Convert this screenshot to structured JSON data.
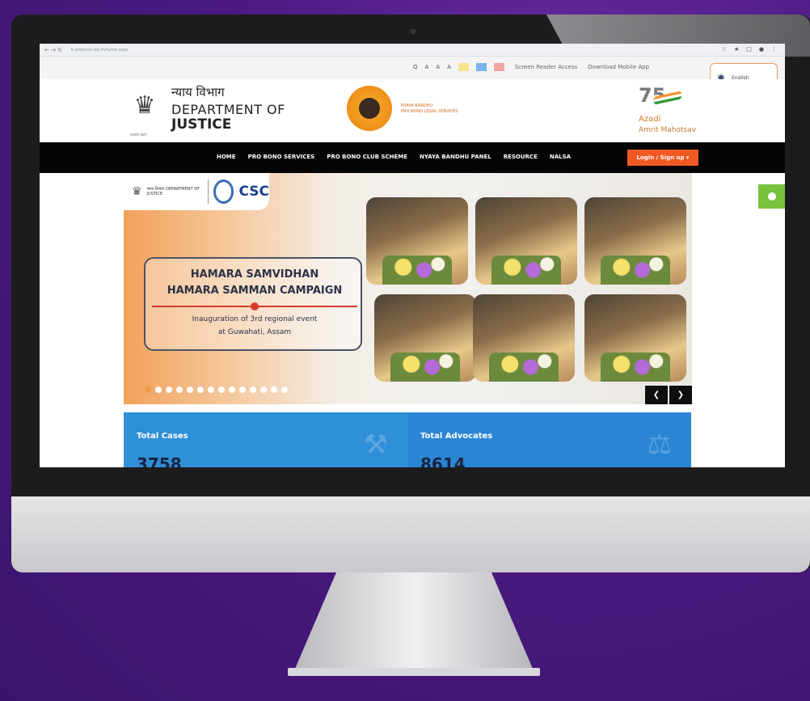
{
  "browser": {
    "nav_glyphs": "← → ↻",
    "url": "⇅  probono-doj.in/home.aspx",
    "icons": [
      "☆",
      "★",
      "□",
      "●",
      "⋮"
    ]
  },
  "utility_bar": {
    "search_glyph": "Q",
    "font_controls": [
      "A",
      "A",
      "A"
    ],
    "swatch_colors": [
      "#f6e58d",
      "#7fb3f0",
      "#f4a3a3"
    ],
    "screen_reader": "Screen Reader Access",
    "download_app": "Download Mobile App",
    "language": "English"
  },
  "header": {
    "hindi_title": "न्याय विभाग",
    "dept_line1": "DEPARTMENT OF",
    "dept_line2": "JUSTICE",
    "emblem_caption": "सत्यमेव जयते",
    "nyaya_line1": "NYAYA BANDHU",
    "nyaya_line2": "PRO BONO LEGAL SERVICES",
    "azadi_75": "75",
    "azadi_line1": "Azadi",
    "azadi_line2": "Amrit Mahotsav"
  },
  "nav": {
    "items": [
      "HOME",
      "PRO BONO SERVICES",
      "PRO BONO CLUB SCHEME",
      "NYAYA BANDHU PANEL",
      "RESOURCE",
      "NALSA"
    ],
    "login": "Login / Sign up ▾"
  },
  "banner": {
    "logo_text": "न्याय विभाग DEPARTMENT OF JUSTICE",
    "csc": "CSC",
    "title_line1": "HAMARA SAMVIDHAN",
    "title_line2": "HAMARA SAMMAN CAMPAIGN",
    "subtitle_line1": "Inauguration of 3rd regional event",
    "subtitle_line2": "at Guwahati, Assam",
    "prev_glyph": "❮",
    "next_glyph": "❯"
  },
  "stats": [
    {
      "label": "Total Cases",
      "value": "3758",
      "icon": "gavel-icon"
    },
    {
      "label": "Total Advocates",
      "value": "8614",
      "icon": "scales-icon"
    }
  ]
}
